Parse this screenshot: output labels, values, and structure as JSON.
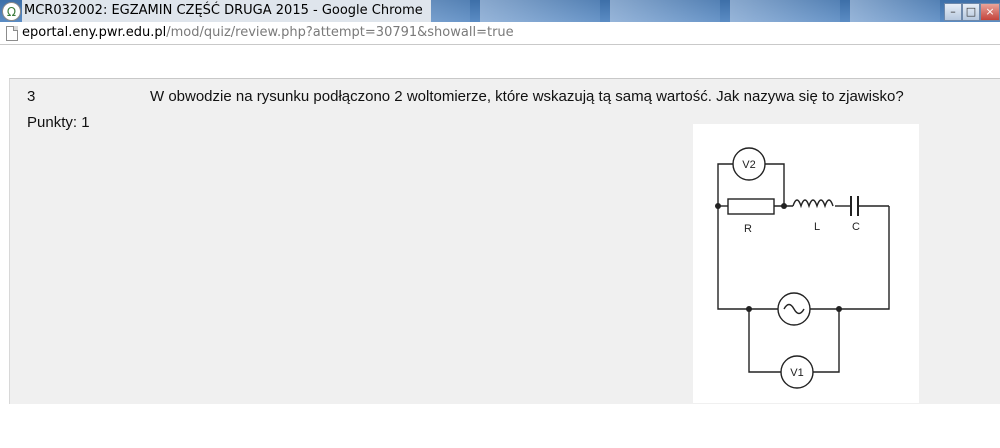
{
  "window": {
    "title": "MCR032002: EGZAMIN CZĘŚĆ DRUGA 2015 - Google Chrome",
    "app_icon": "chrome-icon"
  },
  "address": {
    "domain": "eportal.eny.pwr.edu.pl",
    "path": "/mod/quiz/review.php?attempt=30791&showall=true",
    "page_icon": "page-icon"
  },
  "question": {
    "number": "3",
    "points": "Punkty: 1",
    "text": "W obwodzie na rysunku podłączono 2 woltomierze, które wskazują tą samą wartość. Jak nazywa się to zjawisko?"
  },
  "circuit": {
    "voltmeter_top": "V2",
    "voltmeter_bottom": "V1",
    "resistor": "R",
    "inductor": "L",
    "capacitor": "C"
  }
}
